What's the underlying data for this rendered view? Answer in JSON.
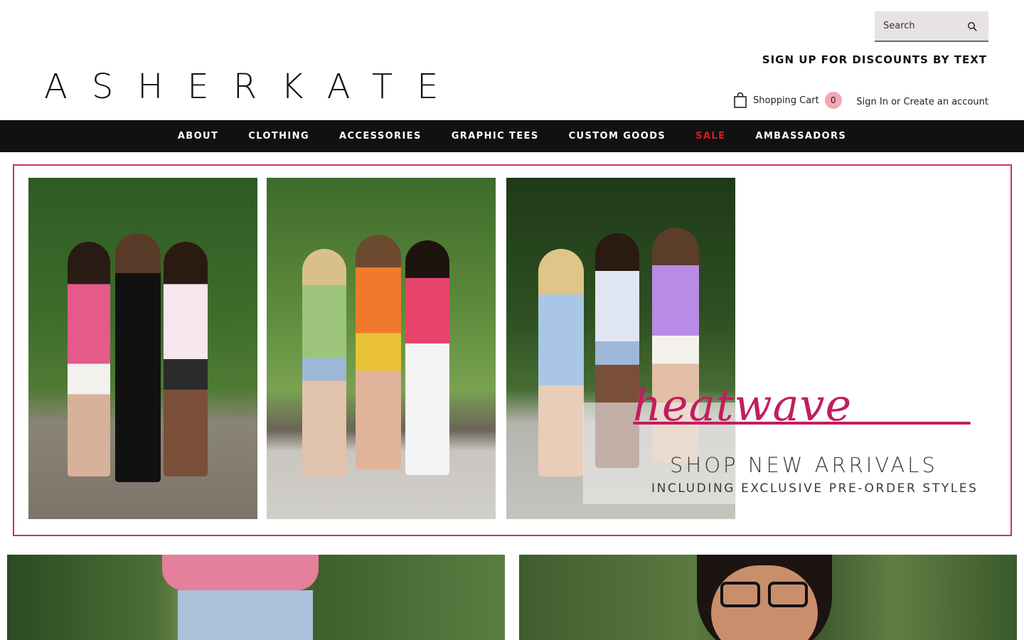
{
  "brand": {
    "logo_text": "ASHERKATE"
  },
  "search": {
    "placeholder": "Search"
  },
  "header": {
    "signup_text": "SIGN UP FOR DISCOUNTS BY TEXT",
    "cart_label": "Shopping Cart",
    "cart_count": "0",
    "signin_label": "Sign In",
    "or_text": "or",
    "create_account_label": "Create an account"
  },
  "nav": {
    "items": [
      {
        "label": "ABOUT"
      },
      {
        "label": "CLOTHING"
      },
      {
        "label": "ACCESSORIES"
      },
      {
        "label": "GRAPHIC TEES"
      },
      {
        "label": "CUSTOM GOODS"
      },
      {
        "label": "SALE",
        "color": "#e0192d"
      },
      {
        "label": "AMBASSADORS"
      }
    ]
  },
  "banner": {
    "script_text": "heatwave",
    "headline": "SHOP NEW ARRIVALS",
    "subheadline": "INCLUDING EXCLUSIVE PRE-ORDER STYLES",
    "accent_color": "#c21d5e"
  },
  "colors": {
    "nav_bg": "#111111",
    "sale": "#e0192d",
    "cart_badge": "#f3a7b3",
    "search_bg": "#e7e3e3"
  }
}
